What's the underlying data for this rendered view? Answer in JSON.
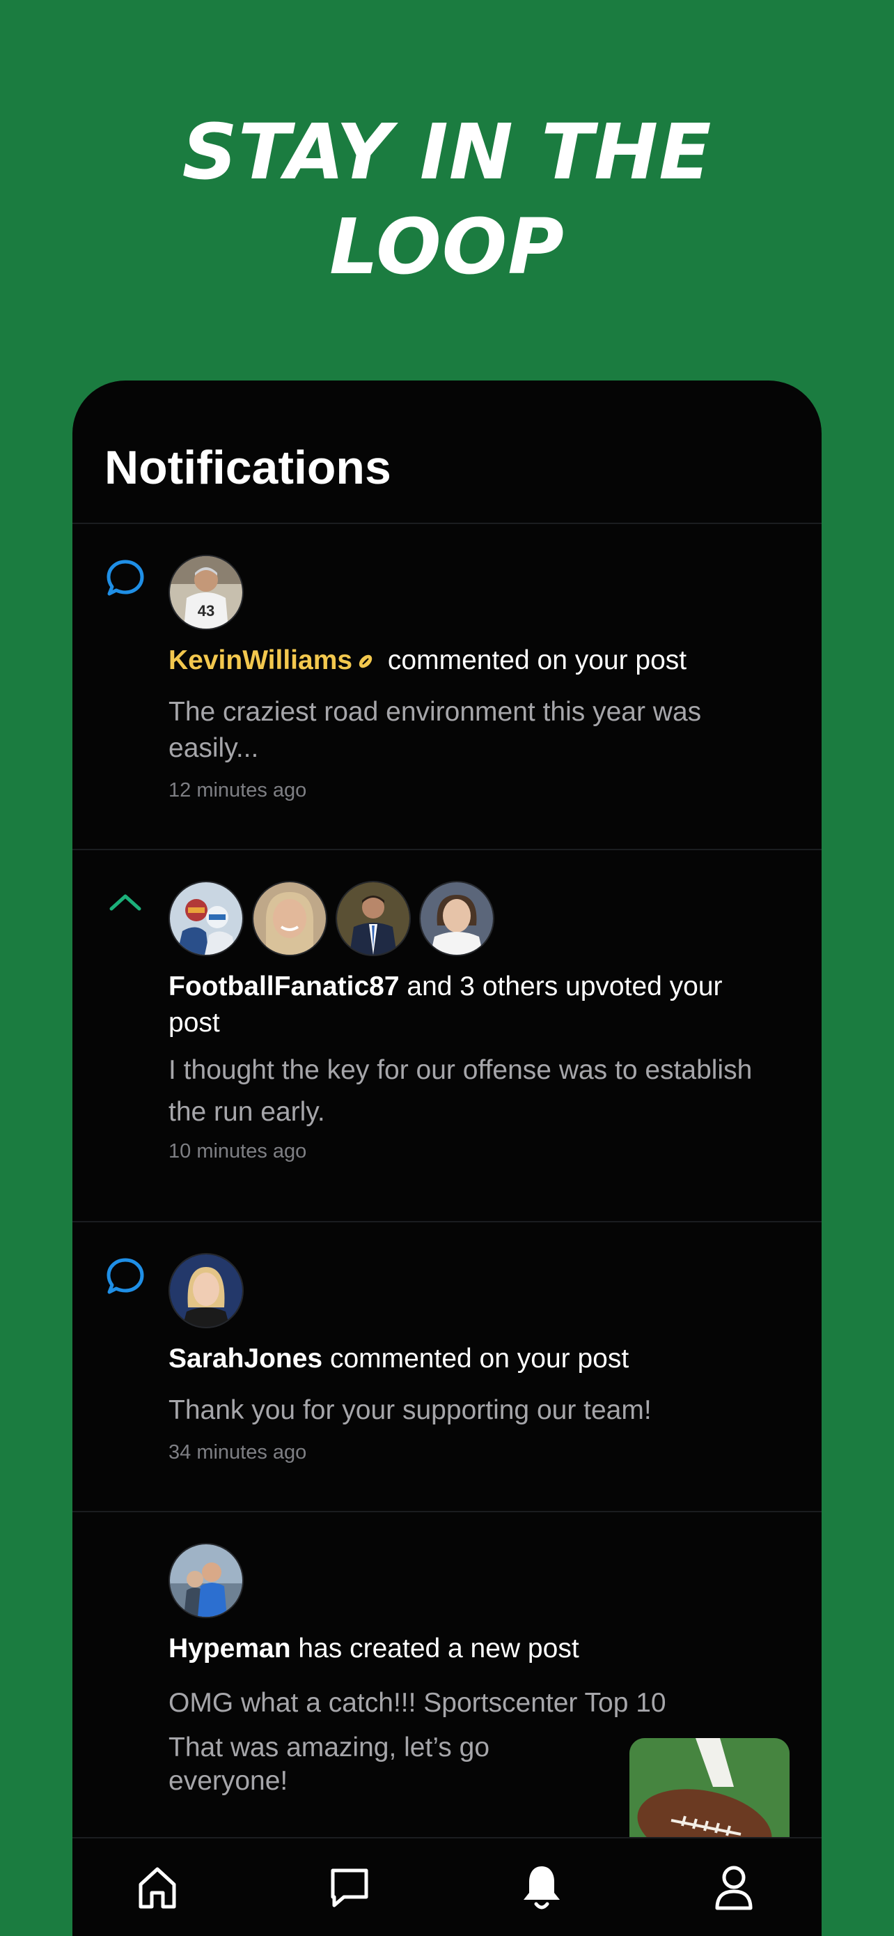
{
  "headline": {
    "line1": "STAY IN THE",
    "line2": "LOOP"
  },
  "screen": {
    "title": "Notifications",
    "notifications": [
      {
        "type_icon": "comment-bubble-icon",
        "user": "KevinWilliams",
        "user_badge": "football-badge-icon",
        "action": " commented on your post",
        "body": "The craziest road environment this year was easily...",
        "time": "12 minutes ago"
      },
      {
        "type_icon": "upvote-chevron-icon",
        "user": "FootballFanatic87",
        "action": " and 3 others upvoted your post",
        "body": "I thought the key for our offense was to establish the run early.",
        "time": "10 minutes ago"
      },
      {
        "type_icon": "comment-bubble-icon",
        "user": "SarahJones",
        "action": " commented on your post",
        "body": "Thank you for your supporting our team!",
        "time": "34 minutes ago"
      },
      {
        "user": "Hypeman",
        "action": " has created a new post",
        "post_title": "OMG what a catch!!! Sportscenter Top 10",
        "body": "That was amazing, let’s go everyone!",
        "thumbnail": "football-photo"
      }
    ],
    "tabbar": [
      "home-icon",
      "chat-icon",
      "bell-icon",
      "profile-icon"
    ]
  },
  "colors": {
    "background": "#1b7c40",
    "panel": "#050505",
    "accent_gold": "#f3c84e",
    "comment_blue": "#1f8fe6",
    "upvote_green": "#1cb07a"
  }
}
